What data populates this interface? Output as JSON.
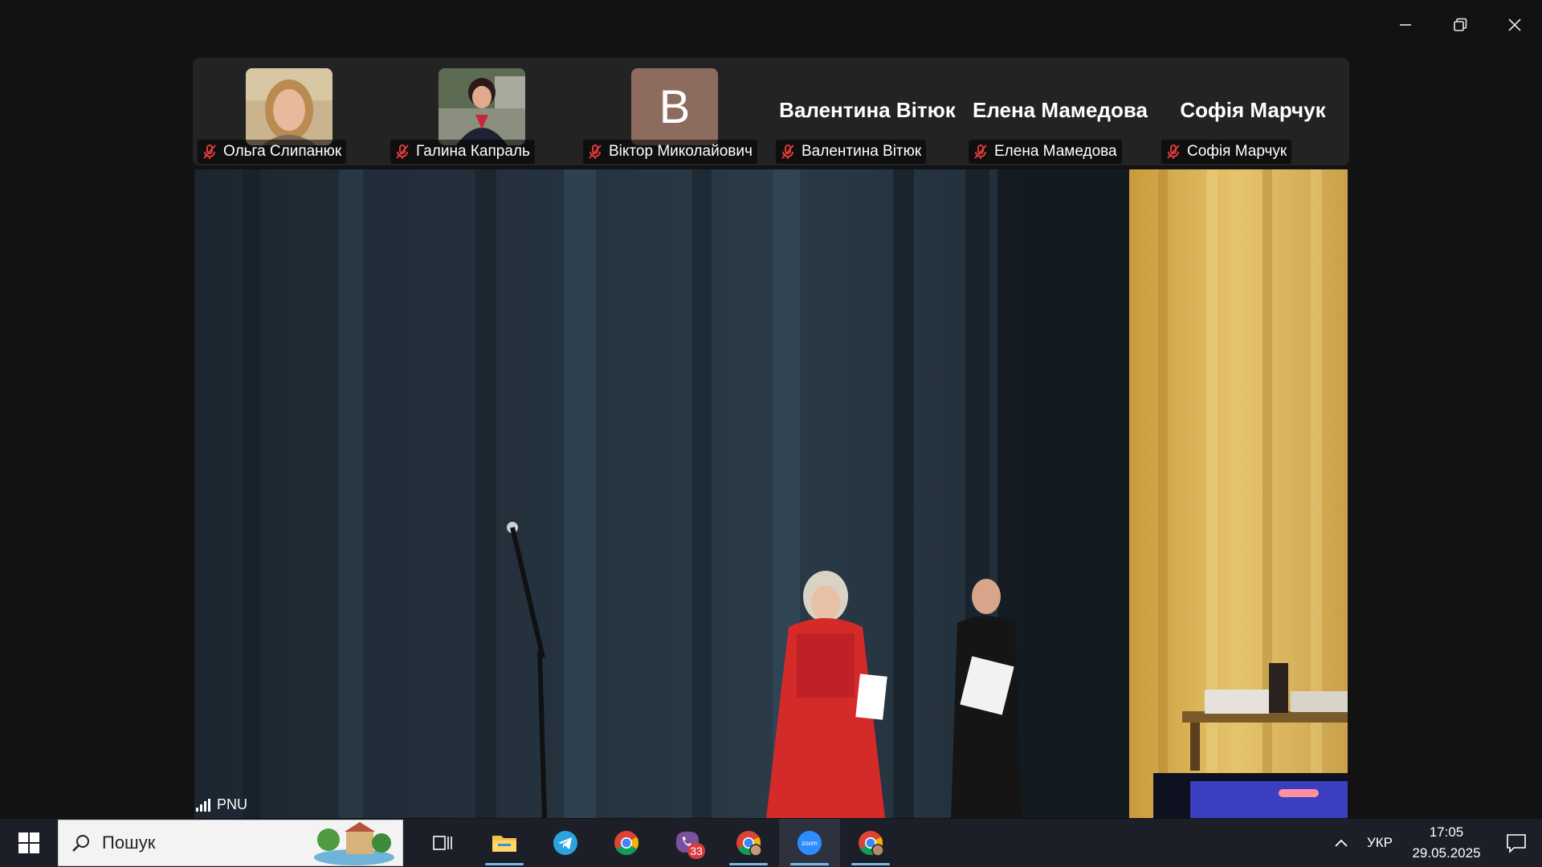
{
  "window": {
    "controls": [
      "minimize",
      "restore",
      "close"
    ]
  },
  "participants": [
    {
      "name": "Ольга Слипанюк",
      "muted": true,
      "video": "photo-woman-blonde"
    },
    {
      "name": "Галина Капраль",
      "muted": true,
      "video": "photo-woman-dark-hair"
    },
    {
      "name": "Віктор Миколайович",
      "muted": true,
      "avatar_letter": "B",
      "avatar_color": "#8e6b5f"
    },
    {
      "name": "Валентина Вітюк",
      "muted": true,
      "display_name": "Валентина Вітюк"
    },
    {
      "name": "Елена Мамедова",
      "muted": true,
      "display_name": "Елена Мамедова"
    },
    {
      "name": "Софія Марчук",
      "muted": true,
      "display_name": "Софія Марчук"
    }
  ],
  "main_video": {
    "speaker_label": "PNU",
    "scene": "stage-with-curtains"
  },
  "taskbar": {
    "search_placeholder": "Пошук",
    "apps": [
      {
        "name": "task-view-icon"
      },
      {
        "name": "file-explorer-icon",
        "active": true
      },
      {
        "name": "telegram-icon"
      },
      {
        "name": "chrome-icon"
      },
      {
        "name": "viber-icon",
        "badge": "33"
      },
      {
        "name": "chrome-profile-icon",
        "active": true
      },
      {
        "name": "zoom-icon",
        "active": true,
        "label": "zoom"
      },
      {
        "name": "chrome-profile-2-icon",
        "active": true
      }
    ],
    "language": "УКР",
    "time": "17:05",
    "date": "29.05.2025"
  },
  "colors": {
    "mute_icon": "#e0393b",
    "taskbar_bg": "#1d1f28",
    "accent": "#76b9ed"
  }
}
